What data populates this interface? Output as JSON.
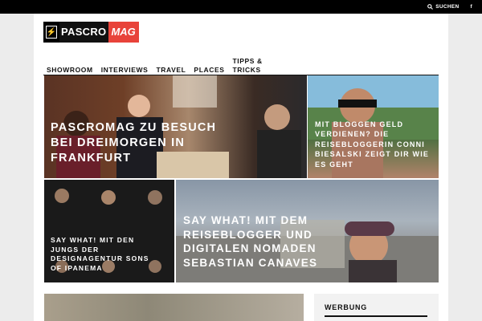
{
  "topbar": {
    "search_label": "SUCHEN",
    "facebook_label": "f"
  },
  "logo": {
    "name": "PASCRO",
    "mag": "MAG",
    "bolt": "⚡"
  },
  "nav": {
    "items": [
      {
        "label": "SHOWROOM"
      },
      {
        "label": "INTERVIEWS"
      },
      {
        "label": "TRAVEL"
      },
      {
        "label": "PLACES"
      },
      {
        "label_line1": "TIPPS &",
        "label_line2": "TRICKS"
      }
    ]
  },
  "tiles": [
    {
      "title": "PASCROMAG ZU BESUCH BEI DREIMORGEN IN FRANKFURT"
    },
    {
      "title": "MIT BLOGGEN GELD VERDIENEN? DIE REISEBLOGGERIN CONNI BIESALSKI ZEIGT DIR WIE ES GEHT"
    },
    {
      "title": "SAY WHAT! MIT DEN JUNGS DER DESIGNAGENTUR SONS OF IPANEMA"
    },
    {
      "title": "SAY WHAT! MIT DEM REISEBLOGGER UND DIGITALEN NOMADEN SEBASTIAN CANAVES"
    }
  ],
  "sidebar": {
    "heading": "WERBUNG"
  },
  "colors": {
    "topbar": "#000000",
    "brand_accent": "#e8433a",
    "background": "#ececec"
  }
}
